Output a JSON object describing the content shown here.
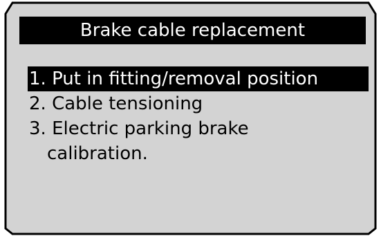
{
  "screen": {
    "title": "Brake cable replacement",
    "background_color": "#d3d3d3",
    "highlight_color": "#000000"
  },
  "menu": {
    "items": [
      {
        "label": "1. Put in fitting/removal position",
        "selected": true
      },
      {
        "label": "2. Cable tensioning",
        "selected": false
      },
      {
        "label": "3. Electric parking brake",
        "selected": false
      },
      {
        "label": "calibration.",
        "selected": false
      }
    ]
  }
}
